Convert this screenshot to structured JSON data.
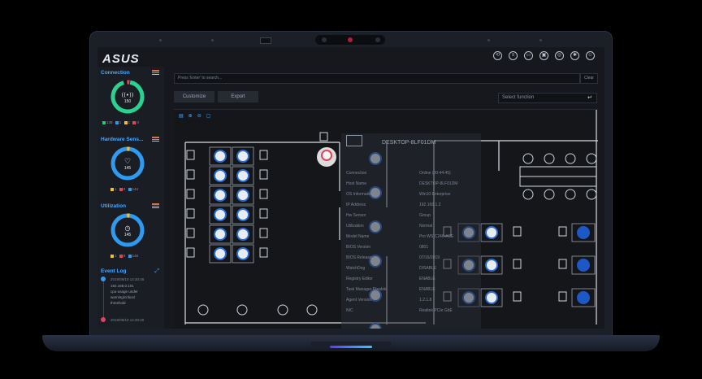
{
  "brand": "ASUS",
  "search": {
    "placeholder": "Press 'Enter' to search...",
    "clear_label": "Clear"
  },
  "toolbar": {
    "customize_label": "Customize",
    "export_label": "Export",
    "select_placeholder": "Select function"
  },
  "sidebar": {
    "connection": {
      "title": "Connection",
      "value": "150",
      "legend": [
        "148",
        "1",
        "1",
        "0"
      ],
      "accent": "#2bd190"
    },
    "hardware": {
      "title": "Hardware Sens...",
      "value": "145",
      "legend": [
        "1",
        "0",
        "144"
      ],
      "accent": "#2e9bf0"
    },
    "utilization": {
      "title": "Utilization",
      "value": "145",
      "legend": [
        "1",
        "0",
        "145"
      ],
      "accent": "#2e9bf0"
    },
    "event_log": {
      "title": "Event Log",
      "entries": [
        {
          "time": "2019/09/10 14:30:48",
          "lines": [
            "192.168.0.101",
            "cpu-usage under",
            "warning/critical",
            "threshold"
          ]
        },
        {
          "time": "2019/09/10 14:30:20",
          "lines": []
        }
      ]
    }
  },
  "detail": {
    "title": "DESKTOP-8LF01DM",
    "rows": [
      {
        "label": "Connection",
        "value": "Online (00:44:45)"
      },
      {
        "label": "Host Name",
        "value": "DESKTOP-8LF01DM"
      },
      {
        "label": "OS Information",
        "value": "Win10 Enterprise"
      },
      {
        "label": "IP Address",
        "value": "192.168.1.2"
      },
      {
        "label": "Hw Sensor",
        "value": "Group"
      },
      {
        "label": "Utilization",
        "value": "Normal"
      },
      {
        "label": "Model Name",
        "value": "Pro WS C246-ACE"
      },
      {
        "label": "BIOS Version",
        "value": "0801"
      },
      {
        "label": "BIOS Release",
        "value": "07/16/2019"
      },
      {
        "label": "WatchDog",
        "value": "DISABLE"
      },
      {
        "label": "Registry Editor",
        "value": "ENABLE"
      },
      {
        "label": "Task Manager Disable",
        "value": "ENABLE"
      },
      {
        "label": "Agent Version",
        "value": "1.2.1.8"
      },
      {
        "label": "NIC",
        "value": "Realtek PCIe GbE"
      }
    ]
  },
  "colors": {
    "green": "#1ec97f",
    "blue": "#2e9bf0",
    "yellow": "#f2c12e",
    "red": "#e1445a"
  }
}
